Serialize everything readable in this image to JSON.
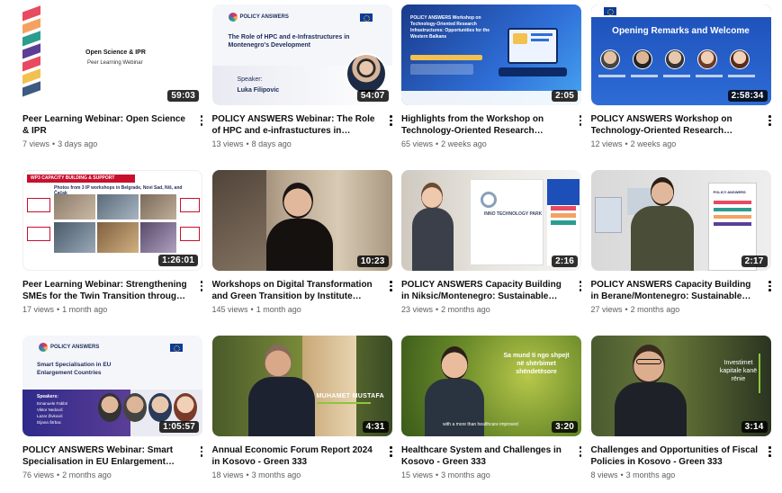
{
  "videos": [
    {
      "title": "Peer Learning Webinar: Open Science & IPR",
      "views": "7 views",
      "age": "3 days ago",
      "duration": "59:03",
      "thumb": {
        "line1": "Open Science & IPR",
        "line2": "Peer Learning Webinar"
      }
    },
    {
      "title": "POLICY ANSWERS Webinar: The Role of HPC and e-infrastuctures in Montenegro's…",
      "views": "13 views",
      "age": "8 days ago",
      "duration": "54:07",
      "thumb": {
        "brand": "POLICY ANSWERS",
        "heading": "The Role of HPC and e-Infrastructures in Montenegro's Development",
        "speaker_label": "Speaker:",
        "speaker_name": "Luka Filipovic"
      }
    },
    {
      "title": "Highlights from the Workshop on Technology-Oriented Research…",
      "views": "65 views",
      "age": "2 weeks ago",
      "duration": "2:05",
      "thumb": {
        "heading": "POLICY ANSWERS Workshop on Technology-Oriented Research Infrastructures: Opportunities for the Western Balkans"
      }
    },
    {
      "title": "POLICY ANSWERS Workshop on Technology-Oriented Research…",
      "views": "12 views",
      "age": "2 weeks ago",
      "duration": "2:58:34",
      "thumb": {
        "heading": "Opening Remarks and Welcome"
      }
    },
    {
      "title": "Peer Learning Webinar: Strengthening SMEs for the Twin Transition through Capacity…",
      "views": "17 views",
      "age": "1 month ago",
      "duration": "1:26:01",
      "thumb": {
        "banner": "WP3 CAPACITY BUILDING & SUPPORT",
        "subhead": "Photos from 3 IP workshops in Belgrade, Novi Sad, Niš, and Čačak"
      }
    },
    {
      "title": "Workshops on Digital Transformation and Green Transition by Institute Mihajlo Pupin …",
      "views": "145 views",
      "age": "1 month ago",
      "duration": "10:23",
      "thumb": {}
    },
    {
      "title": "POLICY ANSWERS Capacity Building in Niksic/Montenegro: Sustainable Agricultur…",
      "views": "23 views",
      "age": "2 months ago",
      "duration": "2:16",
      "thumb": {
        "sign": "INNO TECHNOLOGY PARK"
      }
    },
    {
      "title": "POLICY ANSWERS Capacity Building in Berane/Montenegro: Sustainable Agricultu…",
      "views": "27 views",
      "age": "2 months ago",
      "duration": "2:17",
      "thumb": {
        "brand": "POLICY ANSWERS"
      }
    },
    {
      "title": "POLICY ANSWERS Webinar: Smart Specialisation in EU Enlargement Countries",
      "views": "76 views",
      "age": "2 months ago",
      "duration": "1:05:57",
      "thumb": {
        "brand": "POLICY ANSWERS",
        "heading": "Smart Specialisation in EU Enlargement Countries",
        "speakers_label": "Speakers:",
        "speakers": [
          "Emanuele Fabbri",
          "Viktor Nedović",
          "Lazar Živković",
          "Dijana Štrbac"
        ]
      }
    },
    {
      "title": "Annual Economic Forum Report 2024 in Kosovo - Green 333",
      "views": "18 views",
      "age": "3 months ago",
      "duration": "4:31",
      "thumb": {
        "caption": "MUHAMET MUSTAFA"
      }
    },
    {
      "title": "Healthcare System and Challenges in Kosovo - Green 333",
      "views": "15 views",
      "age": "3 months ago",
      "duration": "3:20",
      "thumb": {
        "overlay": "Sa mund ti ngo shpejt në shërbimet shëndetësore",
        "subtitle": "with a more than healthcare improved"
      }
    },
    {
      "title": "Challenges and Opportunities of Fiscal Policies in Kosovo - Green 333",
      "views": "8 views",
      "age": "3 months ago",
      "duration": "3:14",
      "thumb": {
        "overlay": "Investimet kapitale kanë rënie"
      }
    }
  ],
  "colors": {
    "text": "#0f0f0f",
    "meta": "#606060",
    "brand_navy": "#1c2b5a",
    "accent_red": "#c8102e"
  }
}
